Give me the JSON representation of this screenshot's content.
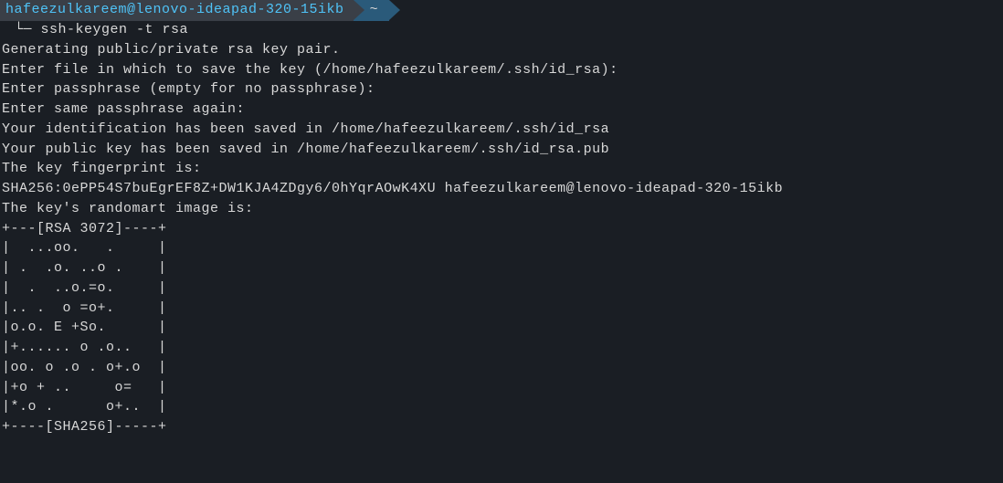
{
  "prompt": {
    "user_host": "hafeezulkareem@lenovo-ideapad-320-15ikb",
    "path": "~"
  },
  "command": {
    "tree": "└─",
    "text": "ssh-keygen -t rsa"
  },
  "output": [
    "Generating public/private rsa key pair.",
    "Enter file in which to save the key (/home/hafeezulkareem/.ssh/id_rsa):",
    "Enter passphrase (empty for no passphrase):",
    "Enter same passphrase again:",
    "Your identification has been saved in /home/hafeezulkareem/.ssh/id_rsa",
    "Your public key has been saved in /home/hafeezulkareem/.ssh/id_rsa.pub",
    "The key fingerprint is:",
    "SHA256:0ePP54S7buEgrEF8Z+DW1KJA4ZDgy6/0hYqrAOwK4XU hafeezulkareem@lenovo-ideapad-320-15ikb",
    "The key's randomart image is:",
    "+---[RSA 3072]----+",
    "|  ...oo.   .     |",
    "| .  .o. ..o .    |",
    "|  .  ..o.=o.     |",
    "|.. .  o =o+.     |",
    "|o.o. E +So.      |",
    "|+...... o .o..   |",
    "|oo. o .o . o+.o  |",
    "|+o + ..     o=   |",
    "|*.o .      o+..  |",
    "+----[SHA256]-----+"
  ]
}
